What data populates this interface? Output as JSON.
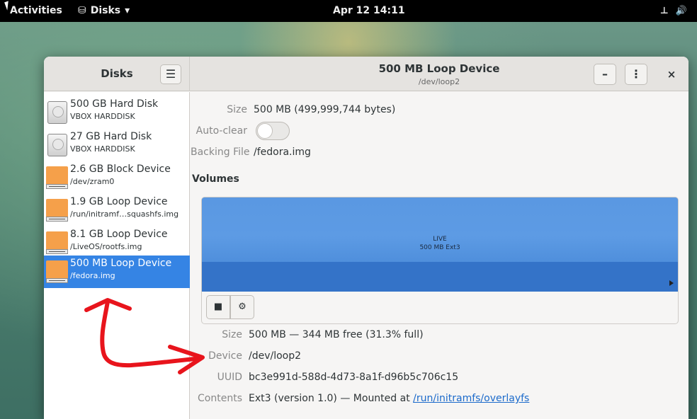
{
  "topbar": {
    "activities": "Activities",
    "app_name": "Disks",
    "clock": "Apr 12  14:11"
  },
  "window": {
    "sidebar_title": "Disks",
    "menu_icon": "☰",
    "title": "500 MB Loop Device",
    "subtitle": "/dev/loop2",
    "minimize_label": "–",
    "more_label": "⋮",
    "close_label": "×"
  },
  "devices": [
    {
      "name": "500 GB Hard Disk",
      "path": "VBOX HARDDISK",
      "icon": "hard-disk-icon"
    },
    {
      "name": "27 GB Hard Disk",
      "path": "VBOX HARDDISK",
      "icon": "hard-disk-icon"
    },
    {
      "name": "2.6 GB Block Device",
      "path": "/dev/zram0",
      "icon": "loop-device-icon"
    },
    {
      "name": "1.9 GB Loop Device",
      "path": "/run/initramf…squashfs.img",
      "icon": "loop-device-icon"
    },
    {
      "name": "8.1 GB Loop Device",
      "path": "/LiveOS/rootfs.img",
      "icon": "loop-device-icon"
    },
    {
      "name": "500 MB Loop Device",
      "path": "/fedora.img",
      "icon": "loop-device-icon",
      "selected": true
    }
  ],
  "details": {
    "size_label": "Size",
    "size_value": "500 MB (499,999,744 bytes)",
    "autoclear_label": "Auto-clear",
    "backing_label": "Backing File",
    "backing_value": "/fedora.img"
  },
  "volumes": {
    "heading": "Volumes",
    "partition_name": "LIVE",
    "partition_desc": "500 MB Ext3",
    "stop_icon": "■",
    "gear_icon": "⚙"
  },
  "partition": {
    "size_label": "Size",
    "size_value": "500 MB — 344 MB free (31.3% full)",
    "device_label": "Device",
    "device_value": "/dev/loop2",
    "uuid_label": "UUID",
    "uuid_value": "bc3e991d-588d-4d73-8a1f-d96b5c706c15",
    "contents_label": "Contents",
    "contents_value": "Ext3 (version 1.0) — Mounted at ",
    "mount_link": "/run/initramfs/overlayfs"
  },
  "colors": {
    "accent": "#3584e4",
    "annotation": "#e8141c",
    "volume_top": "#5d9be4",
    "volume_bottom": "#3473c8",
    "loop_icon": "#f5a04a"
  }
}
